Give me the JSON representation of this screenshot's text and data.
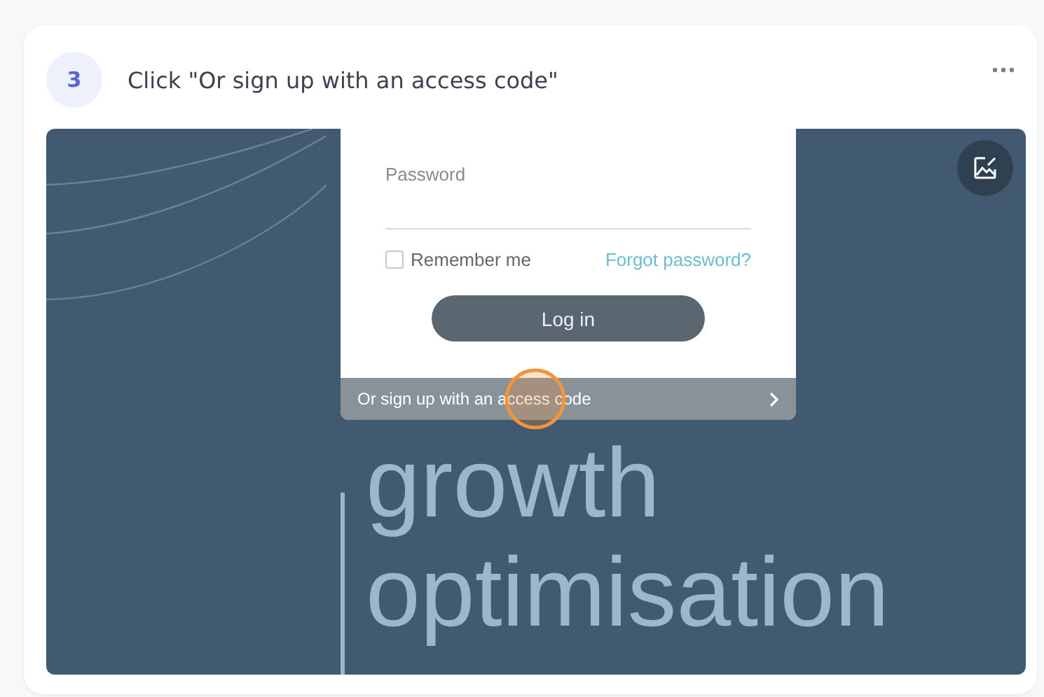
{
  "step": {
    "number": "3",
    "title": "Click \"Or sign up with an access code\""
  },
  "screenshot": {
    "login": {
      "password_label": "Password",
      "remember": {
        "label": "Remember me",
        "checked": false
      },
      "forgot_link": "Forgot password?",
      "login_button": "Log in",
      "access_bar": "Or sign up with an access code"
    },
    "headline": [
      "growth",
      "optimisation"
    ]
  }
}
